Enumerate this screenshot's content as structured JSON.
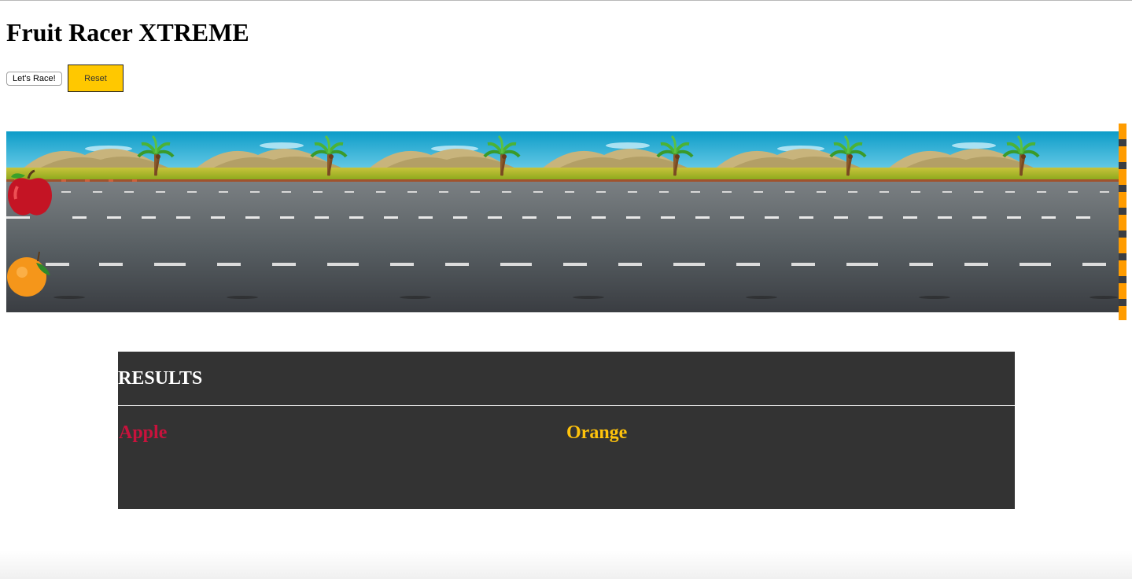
{
  "page": {
    "title": "Fruit Racer XTREME"
  },
  "controls": {
    "race_label": "Let's Race!",
    "reset_label": "Reset",
    "reset_color": "#ffc800"
  },
  "track": {
    "racers": [
      {
        "name": "apple",
        "icon": "apple-icon",
        "progress": 0
      },
      {
        "name": "orange",
        "icon": "orange-icon",
        "progress": 0
      }
    ],
    "finish_line_color": "#ff9c00",
    "sky_color": "#1aa6cf",
    "road_color": "#5a6165"
  },
  "results": {
    "heading": "RESULTS",
    "columns": [
      {
        "label": "Apple",
        "color": "#c8123c"
      },
      {
        "label": "Orange",
        "color": "#ffc30b"
      }
    ]
  }
}
